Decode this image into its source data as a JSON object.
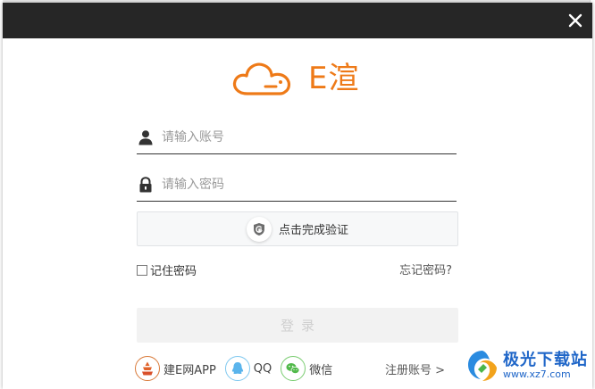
{
  "window": {
    "close_icon": "close-icon"
  },
  "logo": {
    "text": "E渲",
    "icon": "cloud-logo-icon",
    "brand_color": "#ee7a18"
  },
  "form": {
    "username_placeholder": "请输入账号",
    "password_placeholder": "请输入密码",
    "username_icon": "user-icon",
    "password_icon": "lock-icon"
  },
  "captcha": {
    "label": "点击完成验证",
    "icon": "shield-icon"
  },
  "remember": {
    "label": "记住密码",
    "checked": false
  },
  "forgot": {
    "label": "忘记密码?"
  },
  "login": {
    "label": "登录"
  },
  "sso": [
    {
      "label": "建E网APP",
      "icon": "jiane-app-icon"
    },
    {
      "label": "QQ",
      "icon": "qq-icon"
    },
    {
      "label": "微信",
      "icon": "wechat-icon"
    }
  ],
  "register": {
    "label": "注册账号 >"
  },
  "watermark": {
    "title": "极光下载站",
    "url": "www.xz7.com"
  }
}
